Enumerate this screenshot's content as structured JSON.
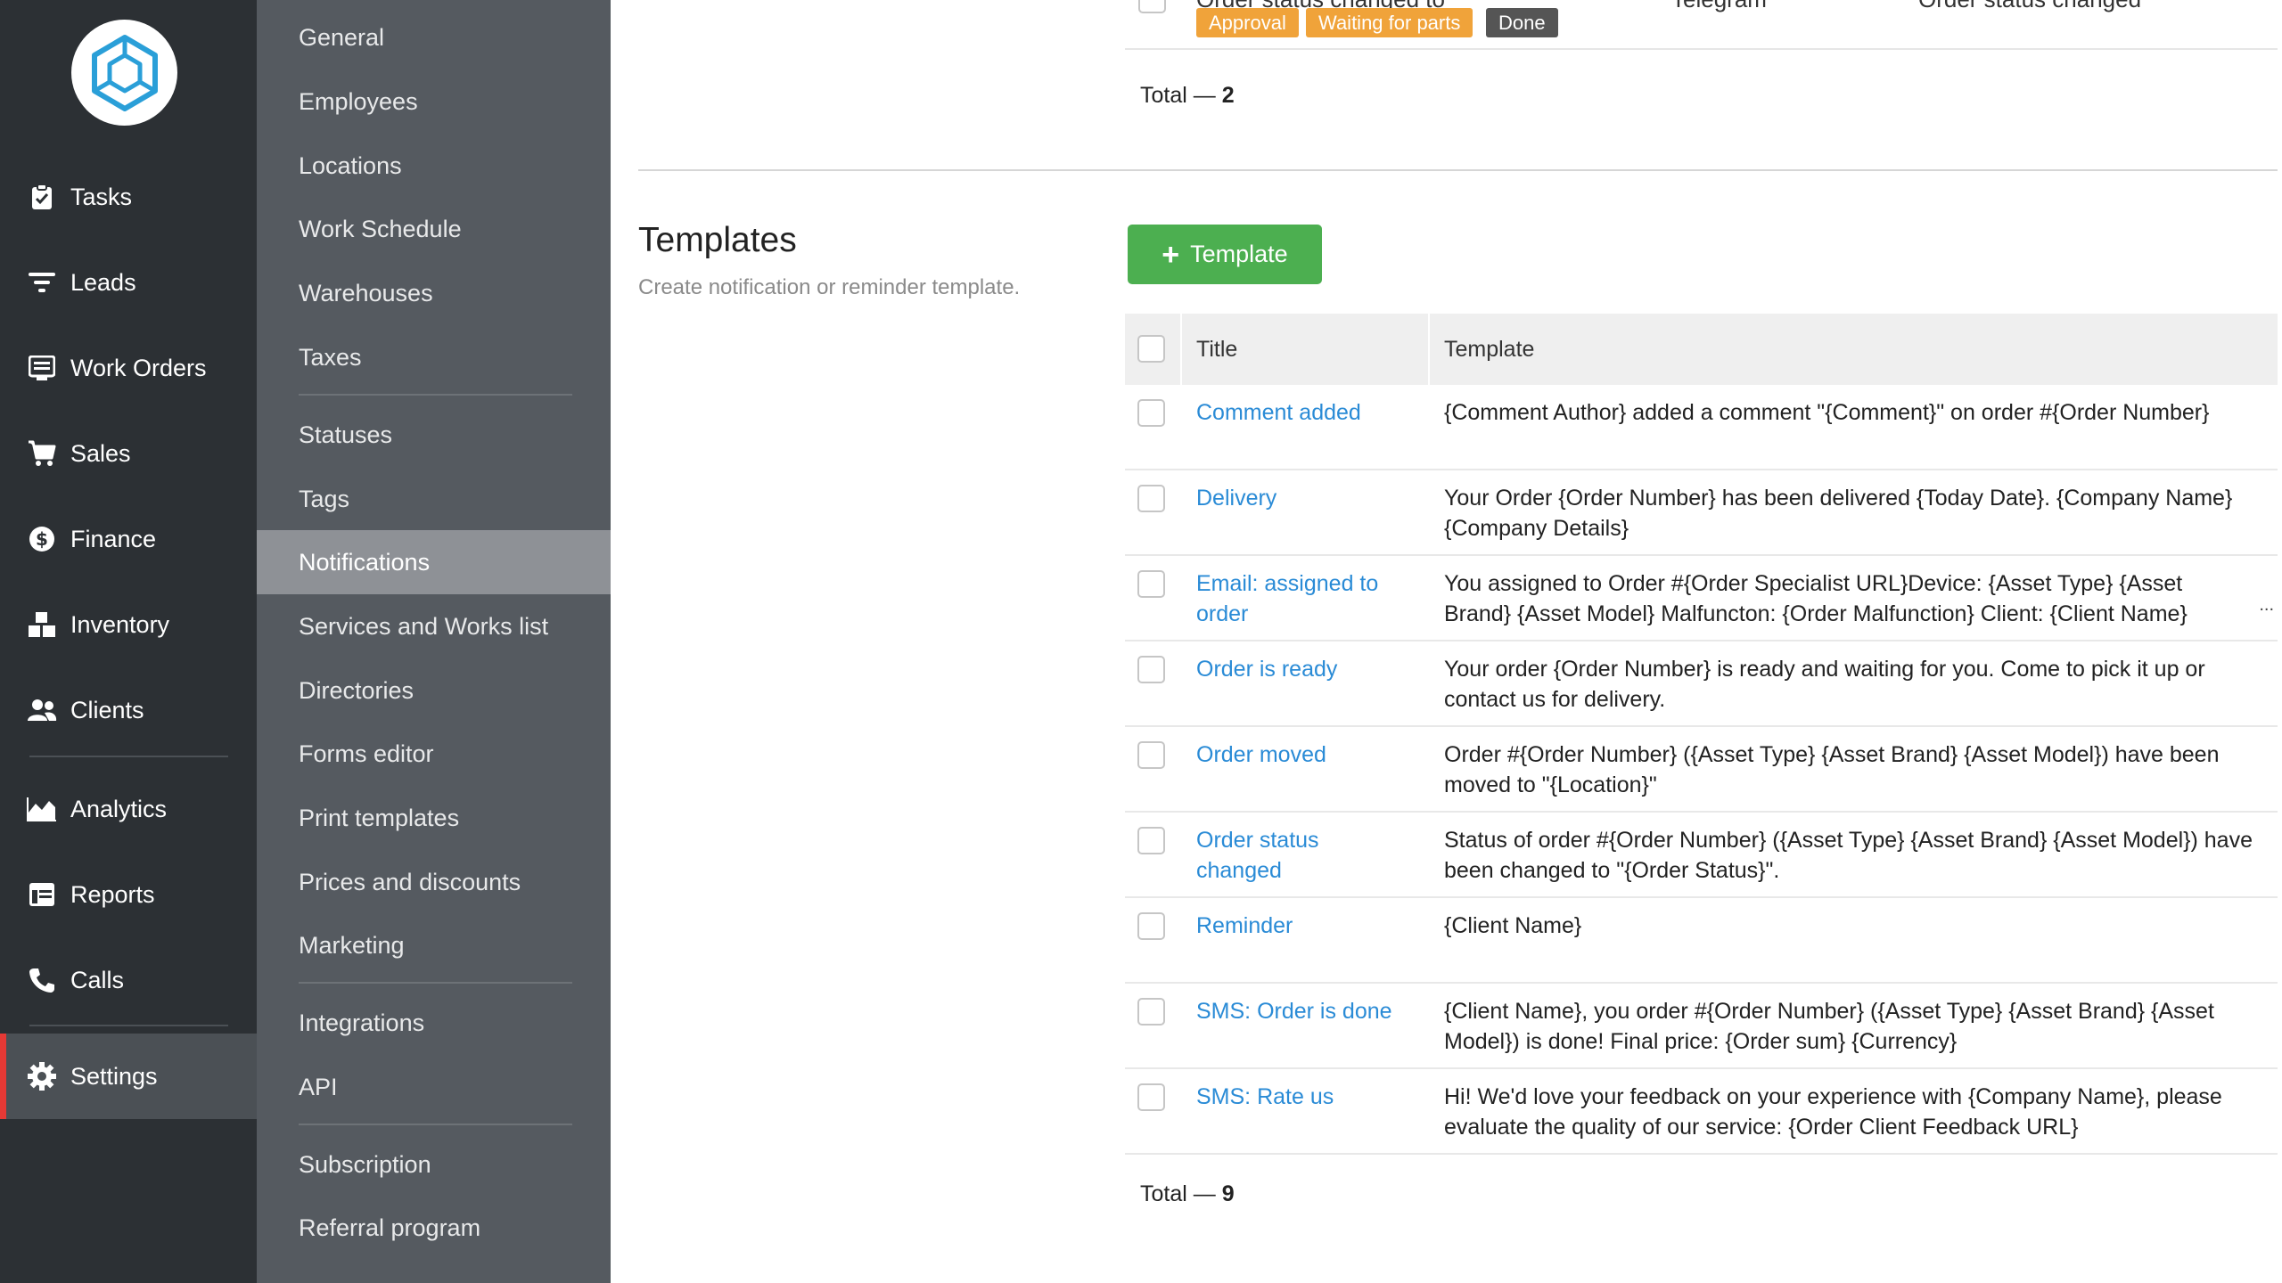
{
  "nav": {
    "items": [
      {
        "label": "Tasks",
        "icon": "clipboard-check-icon"
      },
      {
        "label": "Leads",
        "icon": "filter-icon"
      },
      {
        "label": "Work Orders",
        "icon": "list-icon"
      },
      {
        "label": "Sales",
        "icon": "cart-icon"
      },
      {
        "label": "Finance",
        "icon": "dollar-icon"
      },
      {
        "label": "Inventory",
        "icon": "boxes-icon"
      },
      {
        "label": "Clients",
        "icon": "users-icon"
      },
      {
        "label": "Analytics",
        "icon": "chart-area-icon"
      },
      {
        "label": "Reports",
        "icon": "table-icon"
      },
      {
        "label": "Calls",
        "icon": "phone-icon"
      },
      {
        "label": "Settings",
        "icon": "gear-icon"
      }
    ],
    "active": "Settings"
  },
  "submenu": {
    "items": [
      "General",
      "Employees",
      "Locations",
      "Work Schedule",
      "Warehouses",
      "Taxes",
      "Statuses",
      "Tags",
      "Notifications",
      "Services and Works list",
      "Directories",
      "Forms editor",
      "Print templates",
      "Prices and discounts",
      "Marketing",
      "Integrations",
      "API",
      "Subscription",
      "Referral program"
    ],
    "active": "Notifications"
  },
  "top_table": {
    "partial_row": {
      "title": "Order status changed to",
      "channel": "Telegram",
      "template": "Order status changed",
      "badges": [
        {
          "label": "Approval",
          "color": "#f0a33a"
        },
        {
          "label": "Waiting for parts",
          "color": "#f0a33a"
        },
        {
          "label": "Done",
          "color": "#555555"
        }
      ]
    },
    "total_label": "Total —",
    "total_count": "2"
  },
  "templates": {
    "title": "Templates",
    "description": "Create notification or reminder template.",
    "add_button": "Template",
    "col_title": "Title",
    "col_template": "Template",
    "rows": [
      {
        "title": "Comment added",
        "template": "{Comment Author} added a comment \"{Comment}\" on order #{Order Number}"
      },
      {
        "title": "Delivery",
        "template": "Your Order {Order Number} has been delivered {Today Date}. {Company Name} {Company Details}"
      },
      {
        "title": "Email: assigned to order",
        "template": "You assigned to Order #{Order Specialist URL}Device: {Asset Type} {Asset Brand} {Asset Model} Malfuncton: {Order Malfunction} Client: {Client Name}",
        "truncated": "..."
      },
      {
        "title": "Order is ready",
        "template": "Your order {Order Number} is ready and waiting for you. Come to pick it up or contact us for delivery."
      },
      {
        "title": "Order moved",
        "template": "Order #{Order Number} ({Asset Type} {Asset Brand} {Asset Model}) have been moved to \"{Location}\""
      },
      {
        "title": "Order status changed",
        "template": "Status of order #{Order Number} ({Asset Type} {Asset Brand} {Asset Model}) have been changed to \"{Order Status}\"."
      },
      {
        "title": "Reminder",
        "template": "{Client Name}"
      },
      {
        "title": "SMS: Order is done",
        "template": "{Client Name}, you order #{Order Number} ({Asset Type} {Asset Brand} {Asset Model}) is done! Final price: {Order sum} {Currency}"
      },
      {
        "title": "SMS: Rate us",
        "template": "Hi! We'd love your feedback on your experience with {Company Name}, please evaluate the quality of our service: {Order Client Feedback URL}"
      }
    ],
    "total_label": "Total —",
    "total_count": "9"
  },
  "colors": {
    "nav_bg": "#2c3034",
    "submenu_bg": "#555a60",
    "active_submenu_bg": "#8e9196",
    "accent_red": "#e53935",
    "button_green": "#4caf50",
    "link_blue": "#2a8bd6",
    "logo_blue": "#2a9fd8"
  }
}
